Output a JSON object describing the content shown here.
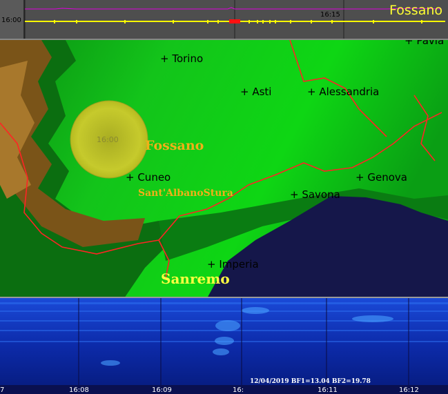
{
  "timeline": {
    "start_time": "16:00",
    "mid_time": "16:15",
    "place": "Fossano"
  },
  "map": {
    "cities": [
      {
        "id": "torino",
        "label": "+ Torino"
      },
      {
        "id": "asti",
        "label": "+ Asti"
      },
      {
        "id": "alessandria",
        "label": "+ Alessandria"
      },
      {
        "id": "pavia",
        "label": "+ Pavia"
      },
      {
        "id": "cuneo",
        "label": "+ Cuneo"
      },
      {
        "id": "savona",
        "label": "+ Savona"
      },
      {
        "id": "genova",
        "label": "+ Genova"
      },
      {
        "id": "imperia",
        "label": "+ Imperia"
      }
    ],
    "highlights": {
      "fossano": "Fossano",
      "sant_albano": "Sant'AlbanoStura",
      "sanremo": "Sanremo"
    },
    "marker_time": "16:00",
    "colors": {
      "lowland": "#0fbf0f",
      "sea": "#15174a",
      "border": "#ff2020",
      "mountains": "#8b5a1a",
      "marker": "#c8cc2a"
    }
  },
  "spectrogram": {
    "info": "12/04/2019 BF1=13.04 BF2=19.78",
    "ticks": [
      "7",
      "16:08",
      "16:09",
      "16:",
      "16:11",
      "16:12"
    ]
  }
}
